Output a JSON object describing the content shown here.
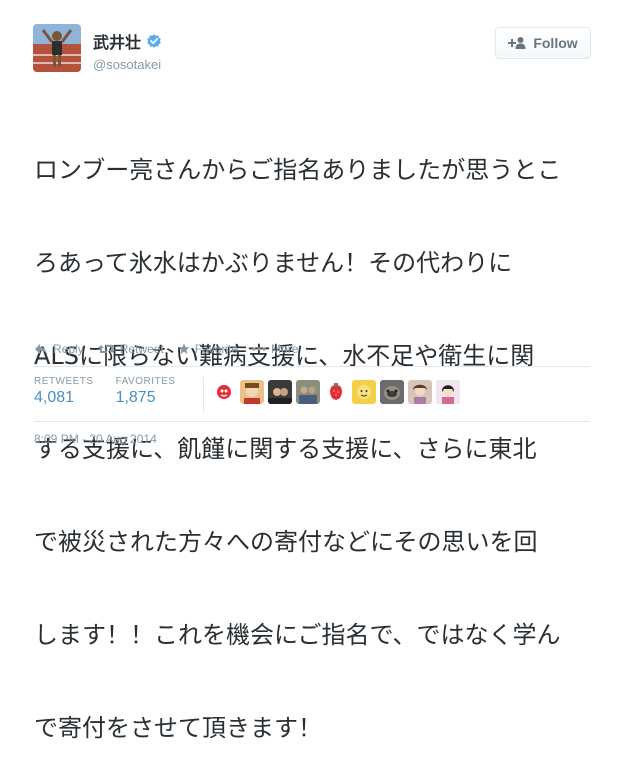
{
  "user": {
    "display_name": "武井壮",
    "handle": "@sosotakei"
  },
  "follow_button": {
    "label": "Follow"
  },
  "tweet": {
    "lines": [
      "ロンブー亮さんからご指名ありましたが思うとこ",
      "ろあって氷水はかぶりません！その代わりに",
      "ALSに限らない難病支援に、水不足や衛生に関",
      "する支援に、飢饉に関する支援に、さらに東北",
      "で被災された方々への寄付などにその思いを回",
      "します！！これを機会にご指名で、ではなく学ん",
      "で寄付をさせて頂きます！"
    ]
  },
  "actions": {
    "reply": "Reply",
    "retweet": "Retweet",
    "favorite": "Favorite",
    "more": "More"
  },
  "stats": {
    "retweets_label": "RETWEETS",
    "retweets_value": "4,081",
    "favorites_label": "FAVORITES",
    "favorites_value": "1,875"
  },
  "timestamp": "8:09 PM - 20 Aug 2014",
  "colors": {
    "accent": "#4a90c2",
    "muted": "#8899a6",
    "verified": "#55acee"
  },
  "favoriter_avatars": [
    "avatar-1",
    "avatar-2",
    "avatar-3",
    "avatar-4",
    "avatar-5",
    "avatar-6",
    "avatar-7",
    "avatar-8",
    "avatar-9",
    "avatar-10"
  ]
}
